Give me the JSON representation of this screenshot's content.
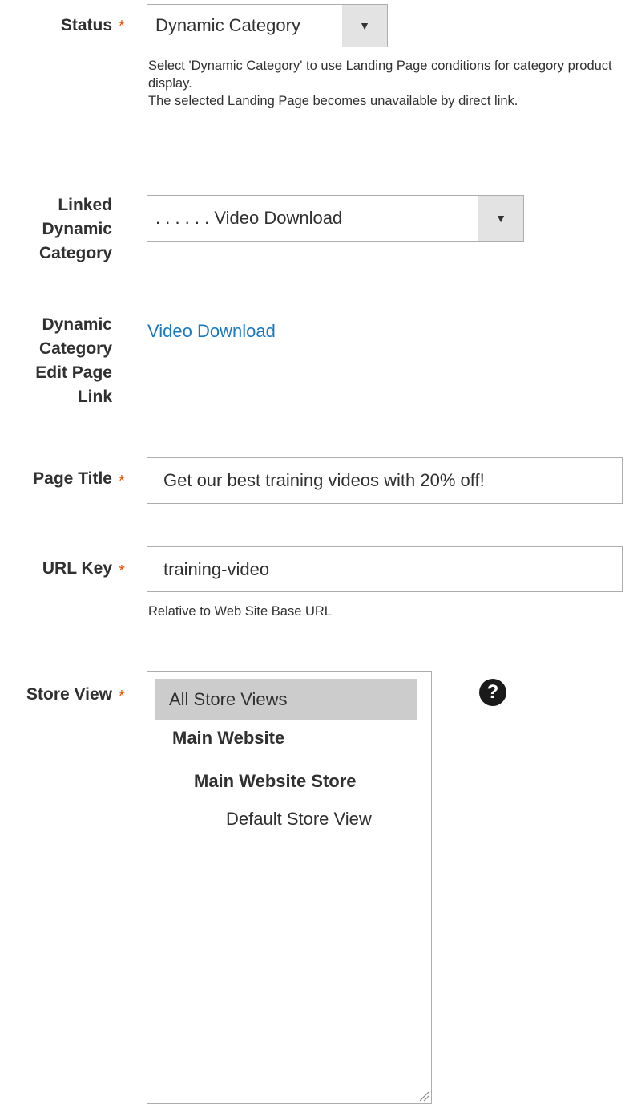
{
  "fields": {
    "status": {
      "label": "Status",
      "value": "Dynamic Category",
      "note_1": "Select 'Dynamic Category' to use Landing Page conditions for category product display.",
      "note_2": "The selected Landing Page becomes unavailable by direct link."
    },
    "linked_category": {
      "label_1": "Linked",
      "label_2": "Dynamic",
      "label_3": "Category",
      "value": ". . . . . . Video Download"
    },
    "edit_link": {
      "label_1": "Dynamic",
      "label_2": "Category",
      "label_3": "Edit Page",
      "label_4": "Link",
      "link_text": "Video Download"
    },
    "page_title": {
      "label": "Page Title",
      "value": "Get our best training videos with 20% off!"
    },
    "url_key": {
      "label": "URL Key",
      "value": "training-video",
      "note": "Relative to Web Site Base URL"
    },
    "store_view": {
      "label": "Store View",
      "options": [
        {
          "text": "All Store Views",
          "selected": true
        },
        {
          "text": "Main Website",
          "selected": false
        },
        {
          "text": "Main Website Store",
          "selected": false
        },
        {
          "text": "Default Store View",
          "selected": false
        }
      ],
      "help_icon": "question-circle-icon"
    }
  },
  "required_mark": "*",
  "dropdown_arrow": "▼",
  "help_glyph": "?",
  "colors": {
    "required": "#eb5202",
    "link": "#1979c3",
    "selected_option_bg": "#cccccc",
    "select_arrow_bg": "#e3e3e3"
  }
}
